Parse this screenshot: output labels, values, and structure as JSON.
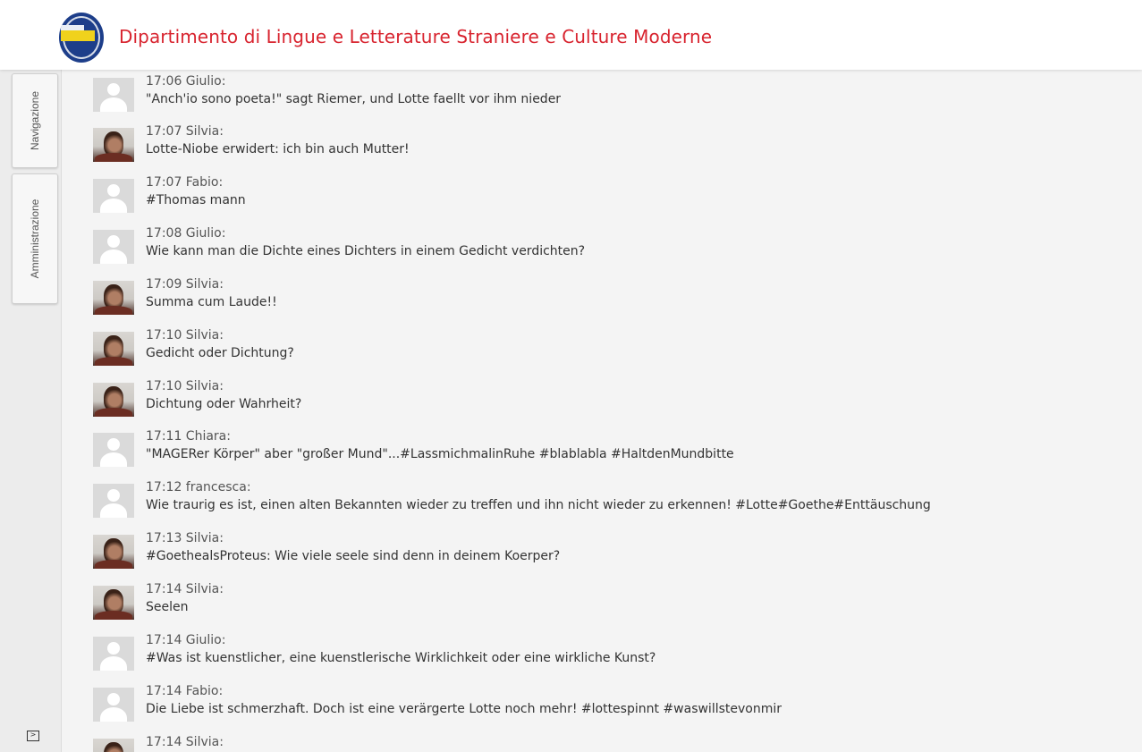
{
  "header": {
    "title": "Dipartimento di Lingue e Letterature Straniere e Culture Moderne",
    "title_color": "#d8242f",
    "logo": "university-seal-logo"
  },
  "sidebar": {
    "tabs": [
      {
        "label": "Navigazione"
      },
      {
        "label": "Amministrazione"
      }
    ],
    "toggle_icon": "expand-panel-icon",
    "toggle_glyph": ">"
  },
  "messages": [
    {
      "time": "17:06",
      "author": "Giulio",
      "meta": "17:06 Giulio:",
      "avatar": "default",
      "text": "\"Anch'io sono poeta!\" sagt Riemer, und Lotte faellt vor ihm nieder"
    },
    {
      "time": "17:07",
      "author": "Silvia",
      "meta": "17:07 Silvia:",
      "avatar": "photo",
      "text": "Lotte-Niobe erwidert: ich bin auch Mutter!"
    },
    {
      "time": "17:07",
      "author": "Fabio",
      "meta": "17:07 Fabio:",
      "avatar": "default",
      "text": "#Thomas mann"
    },
    {
      "time": "17:08",
      "author": "Giulio",
      "meta": "17:08 Giulio:",
      "avatar": "default",
      "text": "Wie kann man die Dichte eines Dichters in einem Gedicht verdichten?"
    },
    {
      "time": "17:09",
      "author": "Silvia",
      "meta": "17:09 Silvia:",
      "avatar": "photo",
      "text": "Summa cum Laude!!"
    },
    {
      "time": "17:10",
      "author": "Silvia",
      "meta": "17:10 Silvia:",
      "avatar": "photo",
      "text": "Gedicht oder Dichtung?"
    },
    {
      "time": "17:10",
      "author": "Silvia",
      "meta": "17:10 Silvia:",
      "avatar": "photo",
      "text": "Dichtung oder Wahrheit?"
    },
    {
      "time": "17:11",
      "author": "Chiara",
      "meta": "17:11 Chiara:",
      "avatar": "default",
      "text": "\"MAGERer Körper\" aber \"großer Mund\"...#LassmichmalinRuhe #blablabla #HaltdenMundbitte"
    },
    {
      "time": "17:12",
      "author": "francesca",
      "meta": "17:12 francesca:",
      "avatar": "default",
      "text": "Wie traurig es ist, einen alten Bekannten wieder zu treffen und ihn nicht wieder zu erkennen! #Lotte#Goethe#Enttäuschung"
    },
    {
      "time": "17:13",
      "author": "Silvia",
      "meta": "17:13 Silvia:",
      "avatar": "photo",
      "text": "#GoethealsProteus: Wie viele seele sind denn in deinem Koerper?"
    },
    {
      "time": "17:14",
      "author": "Silvia",
      "meta": "17:14 Silvia:",
      "avatar": "photo",
      "text": "Seelen"
    },
    {
      "time": "17:14",
      "author": "Giulio",
      "meta": "17:14 Giulio:",
      "avatar": "default",
      "text": "#Was ist kuenstlicher, eine kuenstlerische Wirklichkeit oder eine wirkliche Kunst?"
    },
    {
      "time": "17:14",
      "author": "Fabio",
      "meta": "17:14 Fabio:",
      "avatar": "default",
      "text": "Die Liebe ist schmerzhaft. Doch ist eine verärgerte Lotte noch mehr! #lottespinnt #waswillstevonmir"
    },
    {
      "time": "17:14",
      "author": "Silvia",
      "meta": "17:14 Silvia:",
      "avatar": "photo",
      "text": ""
    }
  ]
}
